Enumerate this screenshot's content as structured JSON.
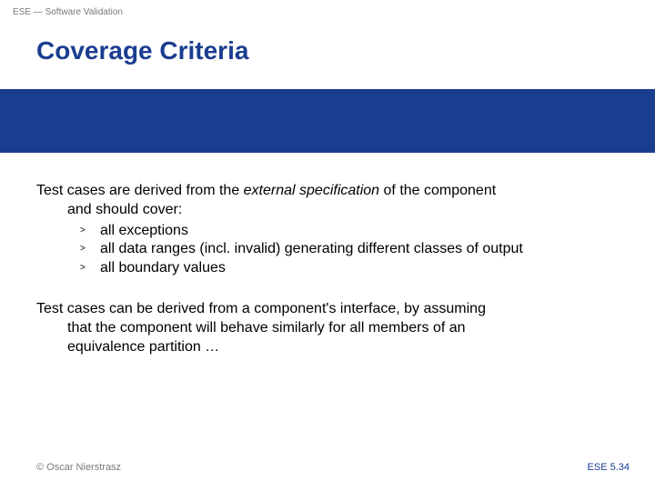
{
  "header": {
    "label": "ESE — Software Validation"
  },
  "title": "Coverage Criteria",
  "para1": {
    "pre": "Test cases are derived from the ",
    "em": "external specification",
    "post": " of the component",
    "cont": "and should cover:"
  },
  "bullets": [
    "all exceptions",
    "all data ranges (incl. invalid) generating different classes of output",
    "all boundary values"
  ],
  "para2": {
    "l1_pre": "Test cases can be derived from a component's ",
    "l1_em": "interface",
    "l1_post": ", by assuming",
    "l2": "that the component will behave similarly for all members of an",
    "l3_em": "equivalence partition",
    "l3_post": " …"
  },
  "footer": {
    "copyright": "© Oscar Nierstrasz",
    "pageref": "ESE 5.34"
  }
}
